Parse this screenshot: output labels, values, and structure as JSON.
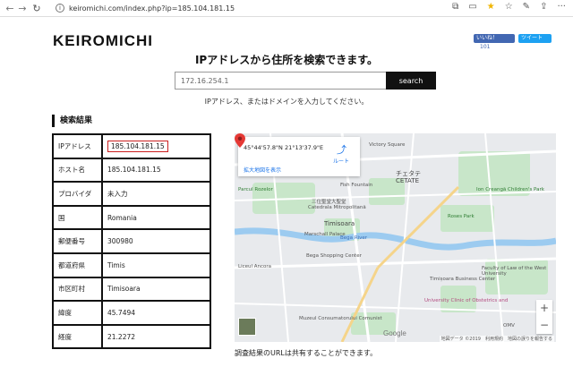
{
  "browser": {
    "url": "keiromichi.com/index.php?ip=185.104.181.15"
  },
  "site": {
    "title": "KEIROMICHI",
    "fb_label": "いいね！",
    "fb_count": "101",
    "tweet_label": "ツイート"
  },
  "heading": "IPアドレスから住所を検索できます。",
  "search": {
    "value": "172.16.254.1",
    "button": "search",
    "hint": "IPアドレス、またはドメインを入力してください。"
  },
  "results": {
    "title": "検索結果",
    "rows": [
      {
        "label": "IPアドレス",
        "value": "185.104.181.15"
      },
      {
        "label": "ホスト名",
        "value": "185.104.181.15"
      },
      {
        "label": "プロバイダ",
        "value": "未入力"
      },
      {
        "label": "国",
        "value": "Romania"
      },
      {
        "label": "郵便番号",
        "value": "300980"
      },
      {
        "label": "都道府県",
        "value": "Timis"
      },
      {
        "label": "市区町村",
        "value": "Timisoara"
      },
      {
        "label": "緯度",
        "value": "45.7494"
      },
      {
        "label": "経度",
        "value": "21.2272"
      }
    ]
  },
  "map": {
    "coords": "45°44'57.8\"N 21°13'37.9\"E",
    "enlarge": "拡大地図を表示",
    "route": "ルート",
    "zoom_in": "+",
    "zoom_out": "−",
    "google": "Google",
    "footer": "地図データ ©2019　利用規約　地図の誤りを報告する",
    "labels": {
      "victory_square": "Victory Square",
      "cetate_jp": "チェタテ",
      "cetate": "CETATE",
      "fish_fountain": "Fish Fountain",
      "park_rozelor": "Parcul Rozelor",
      "cathedral": "三位聖堂大聖堂",
      "cathedral_en": "Catedrala Mitropolitană",
      "timisoara": "Timisoara",
      "roses_park": "Roses Park",
      "marschall_palace": "Marschall Palace",
      "bega_river": "Bega River",
      "liceul_ancora": "Liceul Ancora",
      "bega_shopping": "Bega Shopping Center",
      "business_center": "Timișoara Business Center",
      "faculty_law": "Faculty of Law of the West University",
      "children_park": "Ion Creangă Children's Park",
      "muzeul": "Muzeul Consumatorului Comunist",
      "clinic": "University Clinic of Obstetrics and",
      "omv": "OMV"
    }
  },
  "share_note": "調査結果のURLは共有することができます。"
}
